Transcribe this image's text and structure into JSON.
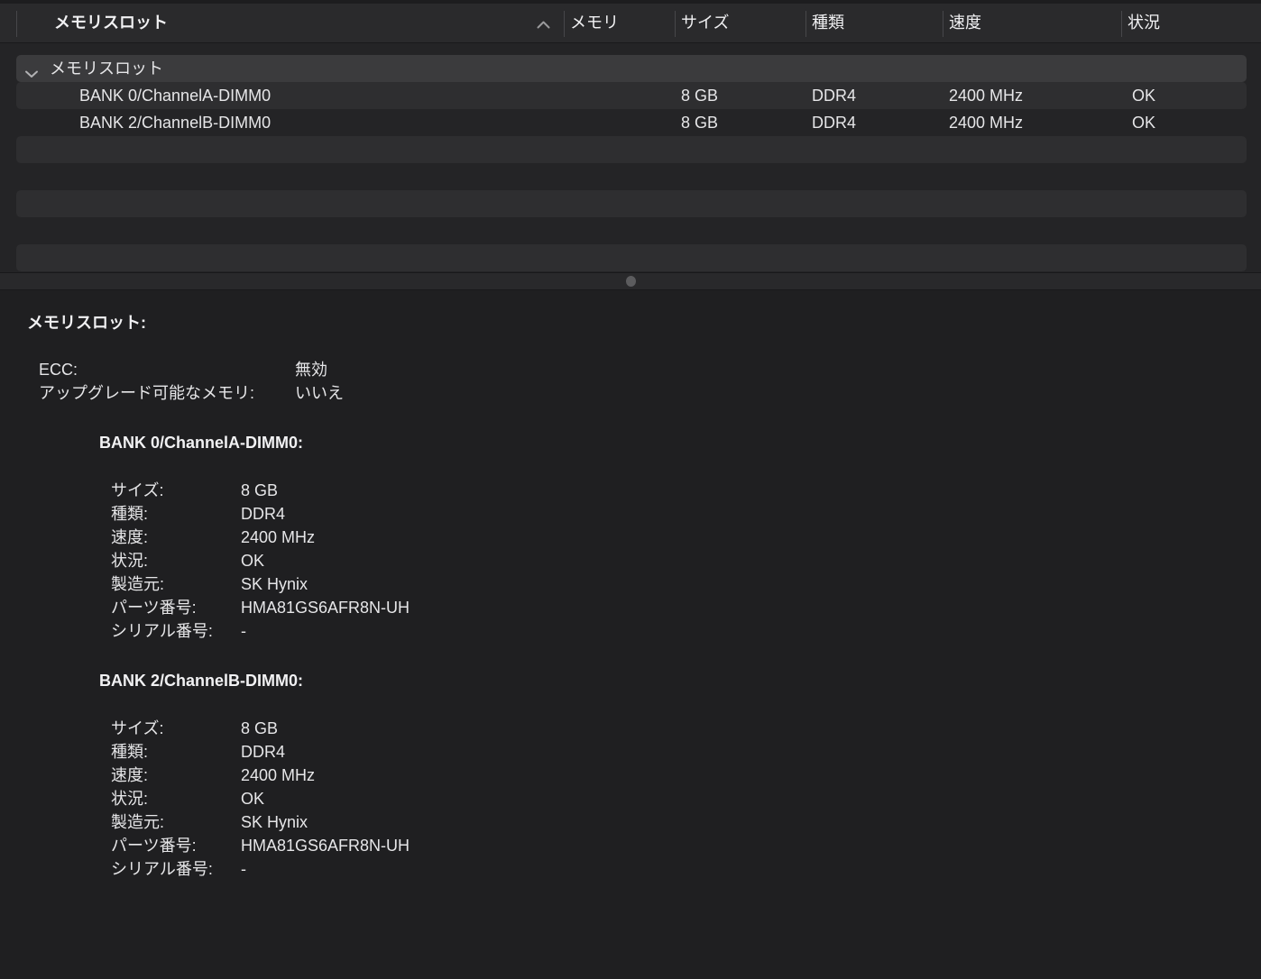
{
  "colors": {
    "header_bg": "#2a2a2c",
    "list_bg": "#242426",
    "stripe_bg": "#2e2e30",
    "group_row_bg": "#3b3b3d",
    "splitter_bg": "#29292b",
    "detail_bg": "#1f1f21",
    "text_primary": "#e8e8ea"
  },
  "list": {
    "columns": [
      {
        "label": "メモリスロット",
        "sorted": "ascending"
      },
      {
        "label": "メモリ"
      },
      {
        "label": "サイズ"
      },
      {
        "label": "種類"
      },
      {
        "label": "速度"
      },
      {
        "label": "状況"
      }
    ],
    "group": {
      "label": "メモリスロット",
      "state": "expanded"
    },
    "rows": [
      {
        "name": "BANK 0/ChannelA-DIMM0",
        "memory": "",
        "size": "8 GB",
        "type": "DDR4",
        "speed": "2400 MHz",
        "status": "OK"
      },
      {
        "name": "BANK 2/ChannelB-DIMM0",
        "memory": "",
        "size": "8 GB",
        "type": "DDR4",
        "speed": "2400 MHz",
        "status": "OK"
      }
    ]
  },
  "details": {
    "title": "メモリスロット:",
    "summary": [
      {
        "label": "ECC:",
        "value": "無効"
      },
      {
        "label": "アップグレード可能なメモリ:",
        "value": "いいえ"
      }
    ],
    "slots": [
      {
        "heading": "BANK 0/ChannelA-DIMM0:",
        "fields": [
          {
            "label": "サイズ:",
            "value": "8 GB"
          },
          {
            "label": "種類:",
            "value": "DDR4"
          },
          {
            "label": "速度:",
            "value": "2400 MHz"
          },
          {
            "label": "状況:",
            "value": "OK"
          },
          {
            "label": "製造元:",
            "value": "SK Hynix"
          },
          {
            "label": "パーツ番号:",
            "value": "HMA81GS6AFR8N-UH"
          },
          {
            "label": "シリアル番号:",
            "value": "-"
          }
        ]
      },
      {
        "heading": "BANK 2/ChannelB-DIMM0:",
        "fields": [
          {
            "label": "サイズ:",
            "value": "8 GB"
          },
          {
            "label": "種類:",
            "value": "DDR4"
          },
          {
            "label": "速度:",
            "value": "2400 MHz"
          },
          {
            "label": "状況:",
            "value": "OK"
          },
          {
            "label": "製造元:",
            "value": "SK Hynix"
          },
          {
            "label": "パーツ番号:",
            "value": "HMA81GS6AFR8N-UH"
          },
          {
            "label": "シリアル番号:",
            "value": "-"
          }
        ]
      }
    ]
  }
}
